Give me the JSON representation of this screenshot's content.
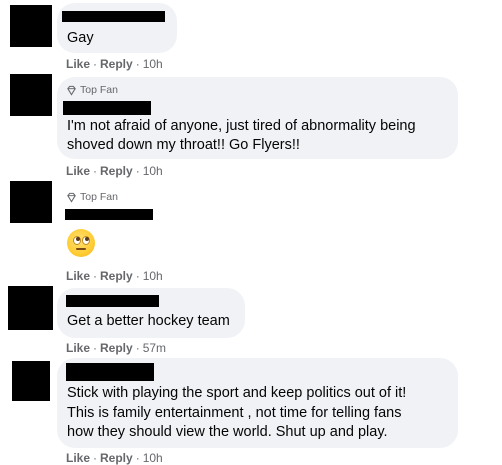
{
  "comments": [
    {
      "badge": "",
      "text_lines": [
        "Gay"
      ],
      "emoji": "",
      "like_label": "Like",
      "reply_label": "Reply",
      "time": "10h"
    },
    {
      "badge": "Top Fan",
      "text_lines": [
        "I'm not afraid of anyone, just tired of abnormality being",
        "shoved down my throat!! Go Flyers!!"
      ],
      "emoji": "",
      "like_label": "Like",
      "reply_label": "Reply",
      "time": "10h"
    },
    {
      "badge": "Top Fan",
      "text_lines": [],
      "emoji": "face-with-rolling-eyes",
      "like_label": "Like",
      "reply_label": "Reply",
      "time": "10h"
    },
    {
      "badge": "",
      "text_lines": [
        "Get a better hockey team"
      ],
      "emoji": "",
      "like_label": "Like",
      "reply_label": "Reply",
      "time": "57m"
    },
    {
      "badge": "",
      "text_lines": [
        "Stick with playing the sport and keep politics out of it!",
        "This is family entertainment , not time for telling fans",
        "how they should view the world. Shut up and play."
      ],
      "emoji": "",
      "like_label": "Like",
      "reply_label": "Reply",
      "time": "10h"
    }
  ],
  "separator": "·",
  "colors": {
    "bubble": "#f0f2f5",
    "meta_text": "#65676b",
    "body_text": "#050505",
    "redaction": "#000000"
  }
}
